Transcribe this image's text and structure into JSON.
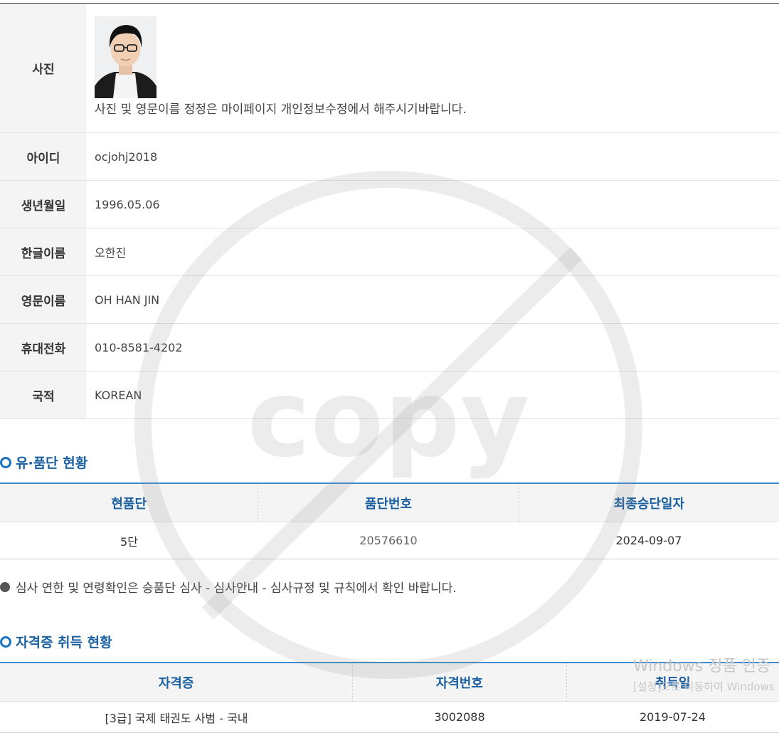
{
  "profile": {
    "photo_label": "사진",
    "photo_note": "사진 및 영문이름 정정은 마이페이지 개인정보수정에서 해주시기바랍니다.",
    "rows": [
      {
        "label": "아이디",
        "value": "ocjohj2018"
      },
      {
        "label": "생년월일",
        "value": "1996.05.06"
      },
      {
        "label": "한글이름",
        "value": "오한진"
      },
      {
        "label": "영문이름",
        "value": "OH HAN JIN"
      },
      {
        "label": "휴대전화",
        "value": "010-8581-4202"
      },
      {
        "label": "국적",
        "value": "KOREAN"
      }
    ]
  },
  "rank_section": {
    "title": "유·품단 현황",
    "headers": [
      "현품단",
      "품단번호",
      "최종승단일자"
    ],
    "row": [
      "5단",
      "20576610",
      "2024-09-07"
    ]
  },
  "notice": "심사 연한 및 연령확인은 승품단 심사 - 심사안내 - 심사규정 및 규칙에서 확인 바랍니다.",
  "cert_section": {
    "title": "자격증 취득 현황",
    "headers": [
      "자격증",
      "자격번호",
      "취득일"
    ],
    "row": [
      "[3급] 국제 태권도 사범 - 국내",
      "3002088",
      "2019-07-24"
    ]
  },
  "watermark": {
    "text": "copy"
  },
  "windows_activation": {
    "line1": "Windows 정품 인증",
    "line2": "[설정]으로 이동하여 Windows"
  },
  "colors": {
    "accent": "#1a73c0",
    "header_text": "#1a5fa0",
    "label_bg": "#f4f4f4"
  }
}
